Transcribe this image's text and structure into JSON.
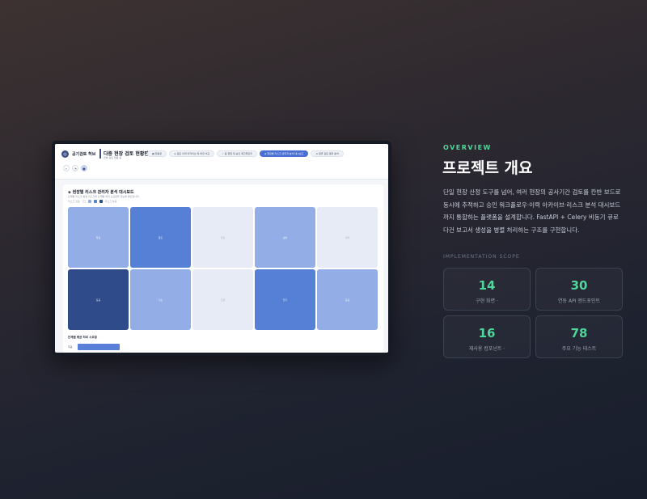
{
  "app": {
    "brand": "공기검토 허브",
    "title": "다중 현장 검토 현황판",
    "subtitle": "전체 검토 현황 총",
    "tabs": [
      {
        "label": "현황판"
      },
      {
        "label": "검토 이력 아카이브 및 버전 비교"
      },
      {
        "label": "팀 협업 및 승인 워크플로우"
      },
      {
        "label": "현장별 리스크 관리자 분석 대시보드"
      },
      {
        "label": "일괄 검토 결과 분석"
      }
    ],
    "active_tab": 3
  },
  "panel": {
    "title": "현장별 리스크 관리자 분석 대시보드",
    "description": "단계별 리스크 발생 리스크와 단계별 처리 소요일을 한눈에 확인합니다.",
    "legend_low": "리스크 낮음",
    "legend_high": "리스크 높음",
    "heat_cells": [
      {
        "label": "착공",
        "level": 2
      },
      {
        "label": "골조",
        "level": 3
      },
      {
        "label": "마감",
        "level": 0
      },
      {
        "label": "설비",
        "level": 2
      },
      {
        "label": "외부",
        "level": 0
      },
      {
        "label": "토공",
        "level": 4
      },
      {
        "label": "기초",
        "level": 2
      },
      {
        "label": "조경",
        "level": 0
      },
      {
        "label": "전기",
        "level": 3
      },
      {
        "label": "준공",
        "level": 2
      }
    ],
    "bars_title": "단계별 평균 처리 소요일",
    "bars": [
      {
        "label": "착공",
        "value": 0.2
      }
    ]
  },
  "colors": {
    "level0": "#e6ebf5",
    "level2": "#93aee6",
    "level3": "#5580d6",
    "level4": "#2f4b8a",
    "accent": "#4fd69a"
  },
  "overview": {
    "eyebrow": "OVERVIEW",
    "heading": "프로젝트 개요",
    "description": "단일 현장 산정 도구를 넘어, 여러 현장의 공사기간 검토를 칸반 보드로 동시에 추적하고 승인 워크플로우·이력 아카이브·리스크 분석 대시보드까지 통합하는 플랫폼을 설계합니다. FastAPI + Celery 비동기 큐로 다건 보고서 생성을 병렬 처리하는 구조를 구현합니다.",
    "scope_label": "IMPLEMENTATION SCOPE",
    "stats": [
      {
        "value": "14",
        "label": "구현 화면 ·"
      },
      {
        "value": "30",
        "label": "연동 API 엔드포인트"
      },
      {
        "value": "16",
        "label": "재사용 컴포넌트 ·"
      },
      {
        "value": "78",
        "label": "주요 기능 테스트"
      }
    ]
  }
}
